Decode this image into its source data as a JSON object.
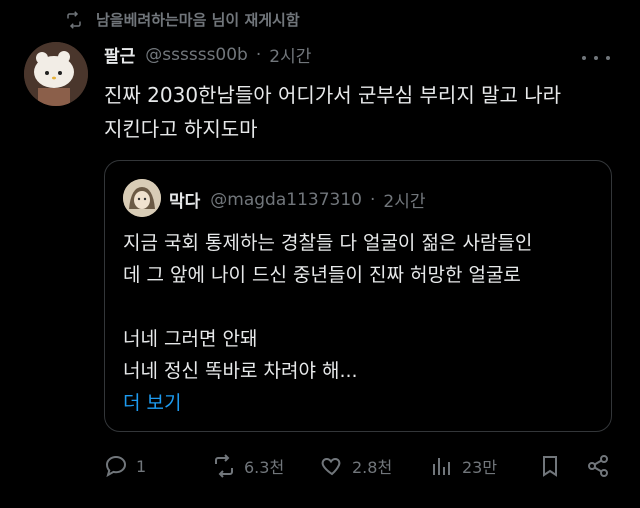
{
  "repost": {
    "text": "남을베려하는마음 님이 재게시함"
  },
  "tweet": {
    "name": "팔근",
    "handle": "@ssssss00b",
    "time": "2시간",
    "lines": [
      "진짜 2030한남들아 어디가서 군부심 부리지 말고 나라",
      "지킨다고 하지도마"
    ]
  },
  "quote": {
    "name": "막다",
    "handle": "@magda1137310",
    "time": "2시간",
    "lines": [
      "지금 국회 통제하는 경찰들 다 얼굴이 젊은 사람들인",
      "데 그 앞에 나이 드신 중년들이 진짜 허망한 얼굴로",
      "",
      "너네 그러면 안돼",
      "너네 정신 똑바로 차려야 해..."
    ],
    "more_label": "더 보기"
  },
  "actions": {
    "replies": "1",
    "reposts": "6.3천",
    "likes": "2.8천",
    "views": "23만"
  },
  "colors": {
    "accent": "#1d9bf0",
    "muted": "#71767b",
    "text": "#e7e9ea",
    "bg": "#000000"
  },
  "icons": [
    "repost-icon",
    "more-icon",
    "reply-icon",
    "like-icon",
    "views-icon",
    "bookmark-icon",
    "share-icon"
  ]
}
